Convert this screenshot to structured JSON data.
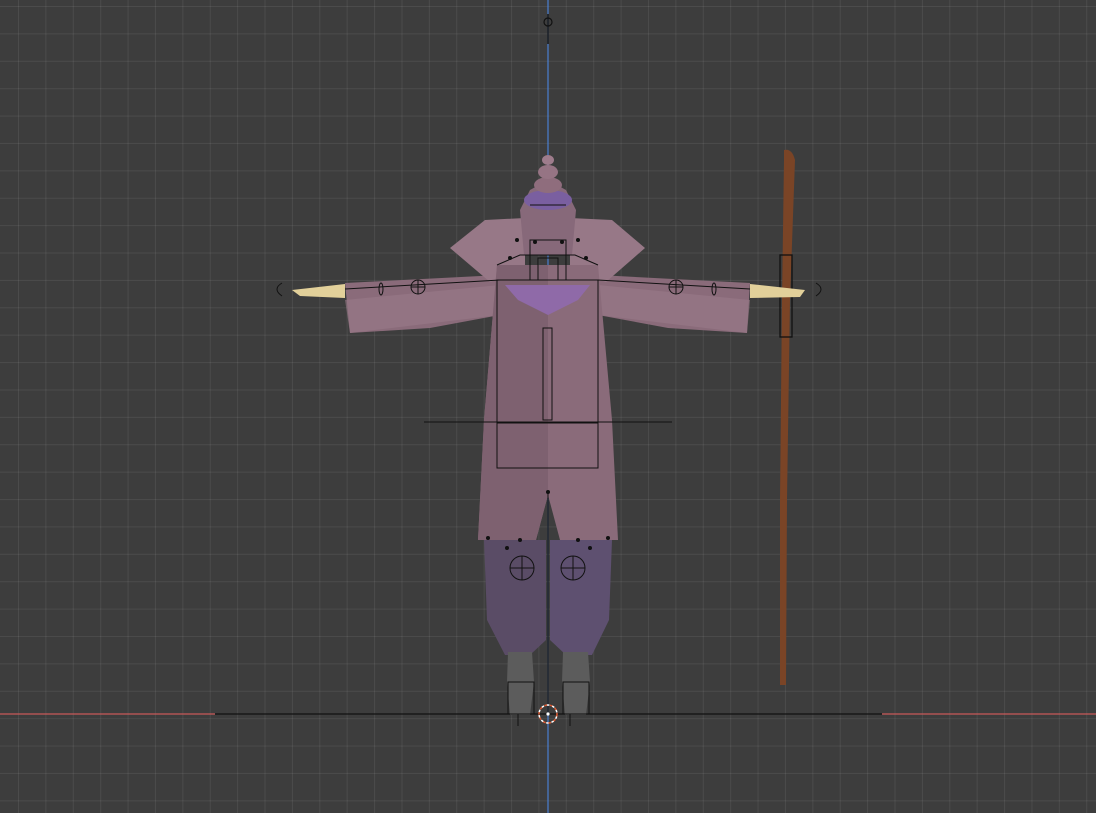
{
  "viewport": {
    "view": "front-orthographic",
    "background_color": "#3d3d3d",
    "grid_color": "#4a4a4a",
    "x_axis_color": "#c85a5a",
    "z_axis_color": "#4a7fd0"
  },
  "scene": {
    "objects": [
      {
        "name": "character-body",
        "color": "#8a6b7a"
      },
      {
        "name": "character-pants",
        "color": "#5a4c66"
      },
      {
        "name": "character-boots",
        "color": "#5c5c5c"
      },
      {
        "name": "character-hands",
        "color": "#e2d09a"
      },
      {
        "name": "collar",
        "color": "#8f6aa8"
      },
      {
        "name": "staff",
        "color": "#7a4426"
      }
    ],
    "armature": {
      "stroke_color": "#111111"
    },
    "cursor": {
      "name": "3d-cursor",
      "color": "#e05a30"
    }
  }
}
